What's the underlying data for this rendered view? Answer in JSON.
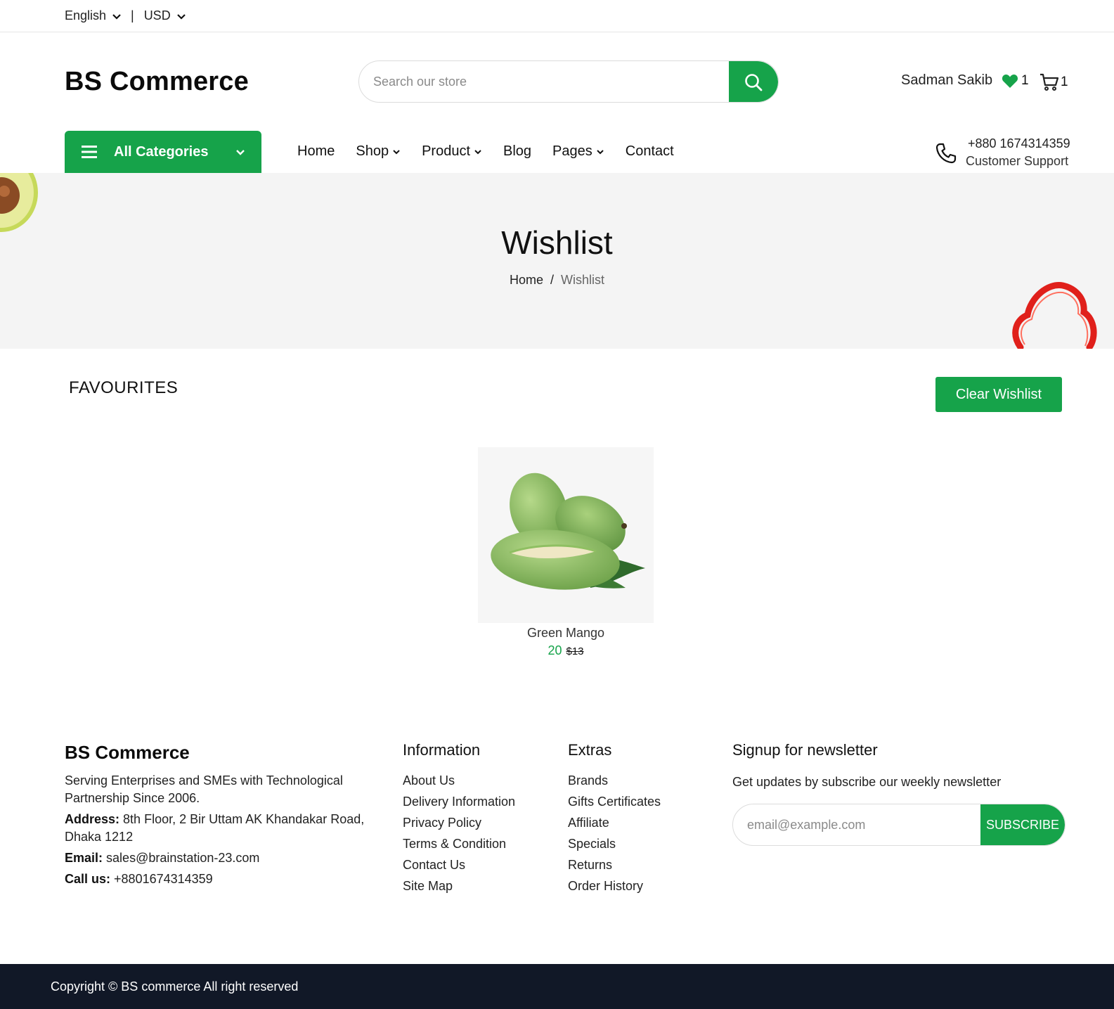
{
  "topbar": {
    "language": "English",
    "separator": "|",
    "currency": "USD"
  },
  "header": {
    "logo": "BS Commerce",
    "search_placeholder": "Search our store",
    "user_name": "Sadman Sakib",
    "wishlist_count": "1",
    "cart_count": "1"
  },
  "nav": {
    "all_categories": "All Categories",
    "items": [
      "Home",
      "Shop",
      "Product",
      "Blog",
      "Pages",
      "Contact"
    ],
    "support_phone": "+880 1674314359",
    "support_label": "Customer Support"
  },
  "banner": {
    "title": "Wishlist",
    "breadcrumb_home": "Home",
    "breadcrumb_sep": "/",
    "breadcrumb_current": "Wishlist"
  },
  "favourites": {
    "title": "FAVOURITES",
    "clear_button": "Clear Wishlist",
    "products": [
      {
        "name": "Green Mango",
        "price": "20",
        "old_price": "$13"
      }
    ]
  },
  "footer": {
    "logo": "BS Commerce",
    "about": "Serving Enterprises and SMEs with Technological Partnership Since 2006.",
    "address_label": "Address:",
    "address": "8th Floor, 2 Bir Uttam AK Khandakar Road, Dhaka 1212",
    "email_label": "Email:",
    "email": "sales@brainstation-23.com",
    "call_label": "Call us:",
    "call": "+8801674314359",
    "information": {
      "title": "Information",
      "links": [
        "About Us",
        "Delivery Information",
        "Privacy Policy",
        "Terms & Condition",
        "Contact Us",
        "Site Map"
      ]
    },
    "extras": {
      "title": "Extras",
      "links": [
        "Brands",
        "Gifts Certificates",
        "Affiliate",
        "Specials",
        "Returns",
        "Order History"
      ]
    },
    "newsletter": {
      "title": "Signup for newsletter",
      "description": "Get updates by subscribe our weekly newsletter",
      "placeholder": "email@example.com",
      "button": "SUBSCRIBE"
    },
    "copyright": "Copyright © BS commerce All right reserved"
  },
  "colors": {
    "accent": "#16a34a",
    "footer_bar": "#111827",
    "banner_bg": "#f4f4f4"
  }
}
